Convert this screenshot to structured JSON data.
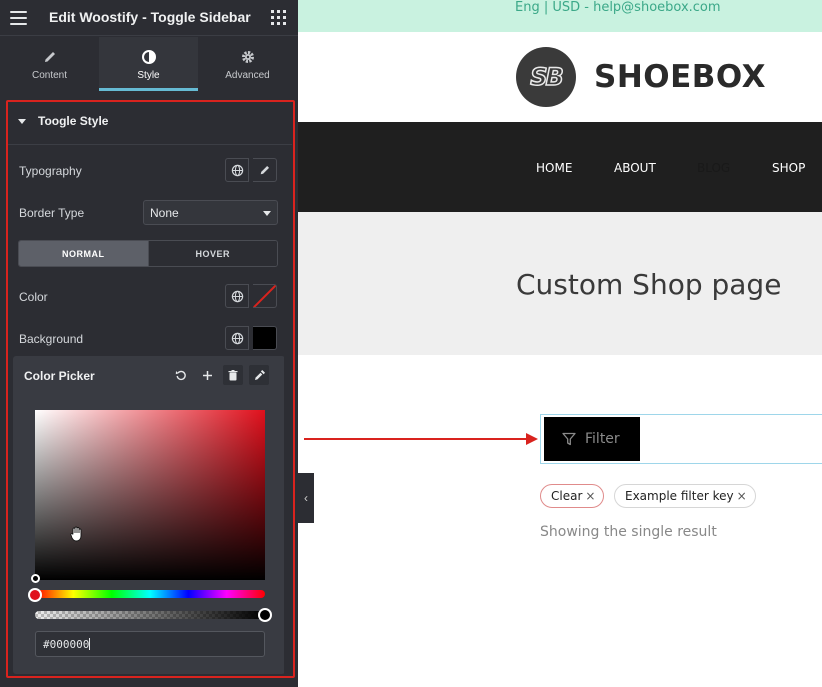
{
  "editor": {
    "title": "Edit Woostify - Toggle Sidebar",
    "tabs": [
      {
        "label": "Content",
        "icon": "pencil-icon"
      },
      {
        "label": "Style",
        "icon": "contrast-icon"
      },
      {
        "label": "Advanced",
        "icon": "gear-icon"
      }
    ],
    "section_title": "Toogle Style",
    "controls": {
      "typography_label": "Typography",
      "border_type_label": "Border Type",
      "border_type_value": "None",
      "state_normal": "NORMAL",
      "state_hover": "HOVER",
      "color_label": "Color",
      "background_label": "Background"
    },
    "color_picker": {
      "title": "Color Picker",
      "hex_value": "#000000",
      "tools": [
        "reset-icon",
        "plus-icon",
        "trash-icon",
        "eyedropper-icon"
      ]
    },
    "colors": {
      "highlight": "#d9231e",
      "accent": "#66bbd4",
      "panel_bg": "#2c2d33"
    }
  },
  "site": {
    "topbar_text": "Eng | USD - help@shoebox.com",
    "logo_mark": "SB",
    "logo_text": "SHOEBOX",
    "nav": [
      "HOME",
      "ABOUT",
      "BLOG",
      "SHOP"
    ],
    "page_title": "Custom Shop page",
    "filter_label": "Filter",
    "chips": [
      {
        "label": "Clear",
        "close": "×"
      },
      {
        "label": "Example filter key",
        "close": "×"
      }
    ],
    "result_text": "Showing the single result",
    "collapse_glyph": "‹"
  }
}
